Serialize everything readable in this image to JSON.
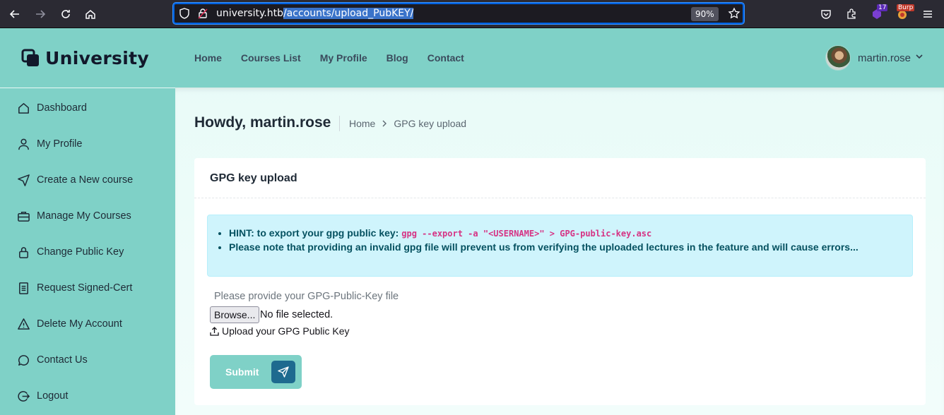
{
  "browser": {
    "url_host": "university.htb",
    "url_path": "/accounts/upload_PubKEY/",
    "zoom": "90%",
    "ext_badge_count": "17",
    "ext_badge_text": "Burp"
  },
  "header": {
    "logo_text": "University",
    "nav": [
      "Home",
      "Courses List",
      "My Profile",
      "Blog",
      "Contact"
    ],
    "username": "martin.rose"
  },
  "sidebar": {
    "items": [
      {
        "label": "Dashboard",
        "icon": "home-icon"
      },
      {
        "label": "My Profile",
        "icon": "user-icon"
      },
      {
        "label": "Create a New course",
        "icon": "send-icon"
      },
      {
        "label": "Manage My Courses",
        "icon": "briefcase-icon"
      },
      {
        "label": "Change Public Key",
        "icon": "lock-icon"
      },
      {
        "label": "Request Signed-Cert",
        "icon": "document-icon"
      },
      {
        "label": "Delete My Account",
        "icon": "warning-icon"
      },
      {
        "label": "Contact Us",
        "icon": "chat-icon"
      },
      {
        "label": "Logout",
        "icon": "logout-icon"
      }
    ]
  },
  "page": {
    "greeting": "Howdy, martin.rose",
    "breadcrumb_home": "Home",
    "breadcrumb_current": "GPG key upload"
  },
  "card": {
    "title": "GPG key upload",
    "hint_label": "HINT: to export your gpg public key:",
    "hint_command": "gpg --export -a \"<USERNAME>\" > GPG-public-key.asc",
    "note": "Please note that providing an invalid gpg file will prevent us from verifying the uploaded lectures in the feature and will cause errors...",
    "file_label": "Please provide your GPG-Public-Key file",
    "browse_label": "Browse...",
    "no_file_text": "No file selected.",
    "upload_hint": "Upload your GPG Public Key",
    "submit_label": "Submit"
  }
}
